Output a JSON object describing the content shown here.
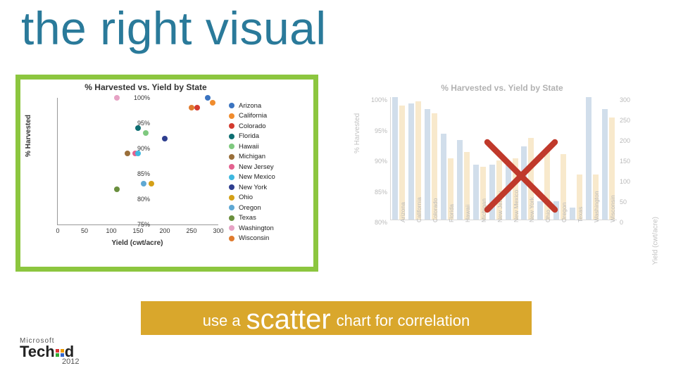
{
  "title": "the right visual",
  "tip": {
    "pre": "use a ",
    "big": "scatter",
    "post": " chart for correlation"
  },
  "brand": {
    "ms": "Microsoft",
    "name": "TechEd",
    "year": "2012"
  },
  "colors": {
    "accent_good": "#8cc63f",
    "accent_tip": "#d9a72c",
    "accent_bad": "#c0392b",
    "bar_harvest": "#9bb7d4",
    "bar_yield": "#f0cf8f"
  },
  "chart_data": [
    {
      "type": "scatter",
      "title": "% Harvested vs. Yield by State",
      "xlabel": "Yield (cwt/acre)",
      "ylabel": "% Harvested",
      "xlim": [
        0,
        300
      ],
      "ylim": [
        75,
        100
      ],
      "xticks": [
        0,
        50,
        100,
        150,
        200,
        250,
        300
      ],
      "yticks": [
        75,
        80,
        85,
        90,
        95,
        100
      ],
      "series": [
        {
          "name": "Arizona",
          "color": "#3b74c0",
          "x": 280,
          "y": 100
        },
        {
          "name": "California",
          "color": "#f08c2e",
          "x": 290,
          "y": 99
        },
        {
          "name": "Colorado",
          "color": "#d33a2f",
          "x": 260,
          "y": 98
        },
        {
          "name": "Florida",
          "color": "#0d6e72",
          "x": 150,
          "y": 94
        },
        {
          "name": "Hawaii",
          "color": "#7fc97f",
          "x": 165,
          "y": 93
        },
        {
          "name": "Michigan",
          "color": "#9a6f3a",
          "x": 130,
          "y": 89
        },
        {
          "name": "New Jersey",
          "color": "#e3618f",
          "x": 145,
          "y": 89
        },
        {
          "name": "New Mexico",
          "color": "#3fb8e0",
          "x": 150,
          "y": 89
        },
        {
          "name": "New York",
          "color": "#2e3e8f",
          "x": 200,
          "y": 92
        },
        {
          "name": "Ohio",
          "color": "#d4a017",
          "x": 175,
          "y": 83
        },
        {
          "name": "Oregon",
          "color": "#5fa8d3",
          "x": 160,
          "y": 83
        },
        {
          "name": "Texas",
          "color": "#6a8f3e",
          "x": 110,
          "y": 82
        },
        {
          "name": "Washington",
          "color": "#e6a2c4",
          "x": 110,
          "y": 100
        },
        {
          "name": "Wisconsin",
          "color": "#e07b2e",
          "x": 250,
          "y": 98
        }
      ]
    },
    {
      "type": "bar",
      "title": "% Harvested vs. Yield by State",
      "xlabel": "",
      "ylabel_left": "% Harvested",
      "ylabel_right": "Yield (cwt/acre)",
      "ylim_left": [
        80,
        100
      ],
      "ylim_right": [
        0,
        300
      ],
      "yticks_left": [
        80,
        85,
        90,
        95,
        100
      ],
      "yticks_right": [
        0,
        50,
        100,
        150,
        200,
        250,
        300
      ],
      "categories": [
        "Arizona",
        "California",
        "Colorado",
        "Florida",
        "Hawaii",
        "Michigan",
        "New Jersey",
        "New Mexico",
        "New York",
        "Ohio",
        "Oregon",
        "Texas",
        "Washington",
        "Wisconsin"
      ],
      "series": [
        {
          "name": "% Harvested",
          "axis": "left",
          "values": [
            100,
            99,
            98,
            94,
            93,
            89,
            89,
            89,
            92,
            83,
            83,
            82,
            100,
            98
          ]
        },
        {
          "name": "Yield",
          "axis": "right",
          "values": [
            280,
            290,
            260,
            150,
            165,
            130,
            145,
            150,
            200,
            175,
            160,
            110,
            110,
            250
          ]
        }
      ]
    }
  ]
}
